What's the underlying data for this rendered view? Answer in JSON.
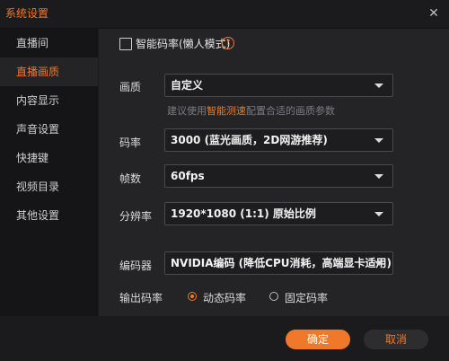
{
  "window": {
    "title": "系统设置",
    "close_icon": "close-icon"
  },
  "sidebar": {
    "items": [
      {
        "label": "直播间"
      },
      {
        "label": "直播画质",
        "active": true
      },
      {
        "label": "内容显示"
      },
      {
        "label": "声音设置"
      },
      {
        "label": "快捷键"
      },
      {
        "label": "视频目录"
      },
      {
        "label": "其他设置"
      }
    ]
  },
  "settings": {
    "smart_bitrate": {
      "label": "智能码率(懒人模式)",
      "checked": false,
      "help_text": "?"
    },
    "quality": {
      "label": "画质",
      "value": "自定义"
    },
    "hint": {
      "prefix": "建议使用",
      "link": "智能测速",
      "suffix": "配置合适的画质参数"
    },
    "bitrate": {
      "label": "码率",
      "value": "3000 (蓝光画质，2D网游推荐)"
    },
    "fps": {
      "label": "帧数",
      "value": "60fps"
    },
    "resolution": {
      "label": "分辨率",
      "value": "1920*1080 (1:1) 原始比例"
    },
    "encoder": {
      "label": "编码器",
      "value": "NVIDIA编码 (降低CPU消耗，高端显卡适用)"
    },
    "output_bitrate": {
      "label": "输出码率",
      "options": [
        {
          "label": "动态码率",
          "selected": true
        },
        {
          "label": "固定码率",
          "selected": false
        }
      ]
    }
  },
  "footer": {
    "confirm": "确定",
    "cancel": "取消"
  },
  "colors": {
    "accent": "#f0782a",
    "background": "#242427",
    "sidebar": "#151517"
  }
}
